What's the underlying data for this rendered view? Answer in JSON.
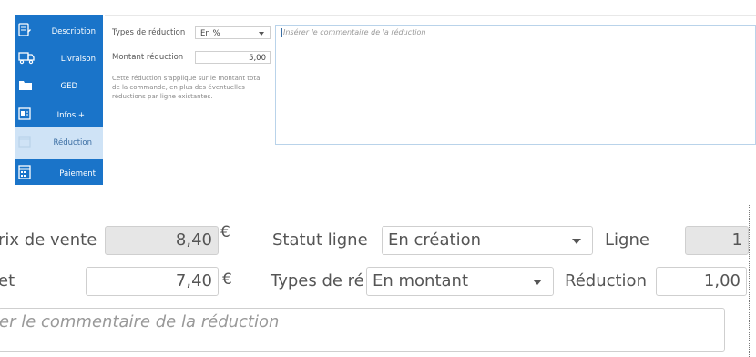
{
  "sidebar": {
    "items": [
      {
        "label": "Description",
        "icon": "document-edit-icon"
      },
      {
        "label": "Livraison",
        "icon": "delivery-truck-icon"
      },
      {
        "label": "GED",
        "icon": "folder-icon"
      },
      {
        "label": "Infos +",
        "icon": "info-card-icon"
      },
      {
        "label": "Réduction",
        "icon": "calendar-icon",
        "active": true
      },
      {
        "label": "Paiement",
        "icon": "calculator-icon"
      }
    ]
  },
  "reduction_panel": {
    "type_label": "Types de réduction",
    "type_value": "En %",
    "amount_label": "Montant réduction",
    "amount_value": "5,00",
    "note": "Cette réduction s'applique sur le montant total de la commande, en plus des éventuelles réductions par ligne existantes.",
    "comment_placeholder": "Insérer le commentaire de la réduction"
  },
  "line_form": {
    "prix_label": "rix de vente",
    "prix_value": "8,40",
    "currency": "€",
    "statut_label": "Statut ligne",
    "statut_value": "En création",
    "ligne_label": "Ligne",
    "ligne_value": "1",
    "net_label": "et",
    "net_value": "7,40",
    "net_currency": "€",
    "types_label": "Types de ré",
    "types_value": "En montant",
    "reduction_label": "Réduction",
    "reduction_value": "1,00",
    "comment_placeholder": "er le commentaire de la réduction"
  },
  "colors": {
    "sidebar_bg": "#1a74c9",
    "sidebar_active_bg": "#cfe3f6",
    "readonly_bg": "#e6e6e6"
  }
}
